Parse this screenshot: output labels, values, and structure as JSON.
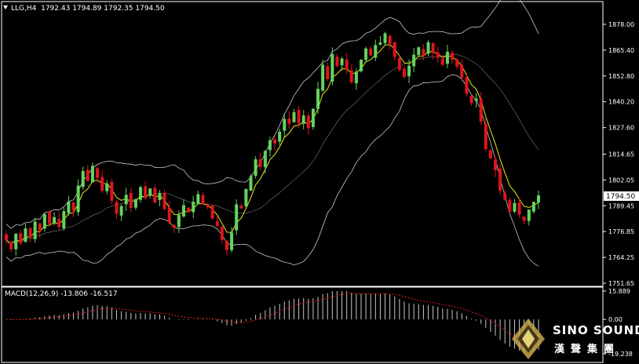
{
  "header": {
    "symbol_label": "LLG,H4",
    "ohlc": [
      "1792.43",
      "1794.89",
      "1792.35",
      "1794.50"
    ]
  },
  "macd": {
    "label": "MACD(12,26,9)",
    "main_value": "-13.806",
    "signal_value": "-16.517"
  },
  "current_price": "1794.50",
  "price_axis": [
    "1878.00",
    "1865.40",
    "1852.80",
    "1840.20",
    "1827.60",
    "1814.65",
    "1802.05",
    "1789.45",
    "1776.85",
    "1764.25",
    "1751.65"
  ],
  "macd_axis": [
    "15.889",
    "0.00",
    "-19.238"
  ],
  "logo": {
    "name": "SINO SOUND",
    "chinese": "漢聲集團"
  },
  "colors": {
    "up": "#64d45c",
    "down": "#e0141e",
    "bands": "#c8c8c8",
    "ma": "#e8e81e",
    "signal": "#e01e1e",
    "histogram": "#c8c8c8",
    "background": "#000000"
  },
  "chart_data": {
    "type": "candlestick",
    "symbol": "LLG",
    "timeframe": "H4",
    "ylim": [
      1751.65,
      1878.0
    ],
    "close": [
      1772.5,
      1768.2,
      1775.8,
      1771.1,
      1778.4,
      1774.0,
      1781.7,
      1777.2,
      1785.4,
      1780.6,
      1783.9,
      1779.1,
      1786.8,
      1791.5,
      1787.0,
      1799.3,
      1806.4,
      1801.6,
      1808.9,
      1803.1,
      1796.7,
      1800.2,
      1791.9,
      1785.6,
      1789.3,
      1794.8,
      1788.4,
      1792.7,
      1798.5,
      1793.2,
      1797.9,
      1791.0,
      1795.6,
      1787.8,
      1781.3,
      1778.6,
      1784.9,
      1789.7,
      1786.2,
      1791.4,
      1795.1,
      1790.3,
      1788.8,
      1783.2,
      1779.5,
      1772.7,
      1767.9,
      1776.4,
      1790.1,
      1788.2,
      1797.6,
      1803.8,
      1812.1,
      1808.5,
      1816.2,
      1821.4,
      1819.8,
      1825.6,
      1831.9,
      1829.4,
      1835.1,
      1829.7,
      1833.5,
      1827.3,
      1836.8,
      1846.5,
      1858.3,
      1851.2,
      1863.4,
      1857.6,
      1861.3,
      1855.8,
      1849.6,
      1854.9,
      1860.7,
      1866.2,
      1862.8,
      1867.9,
      1869.1,
      1873.6,
      1868.4,
      1862.1,
      1855.7,
      1852.3,
      1857.8,
      1863.2,
      1866.8,
      1862.5,
      1869.3,
      1864.0,
      1861.7,
      1858.2,
      1864.6,
      1860.8,
      1857.4,
      1852.0,
      1844.1,
      1839.6,
      1841.8,
      1830.4,
      1817.1,
      1812.5,
      1806.8,
      1796.7,
      1792.4,
      1786.5,
      1790.8,
      1785.2,
      1782.1,
      1787.6,
      1791.3,
      1794.5
    ],
    "bollinger": {
      "period": 20,
      "upper": "plotted",
      "lower": "plotted"
    },
    "moving_average": "plotted",
    "macd": {
      "params": [
        12,
        26,
        9
      ],
      "main": -13.806,
      "signal": -16.517,
      "ylim": [
        -19.238,
        15.889
      ]
    }
  }
}
